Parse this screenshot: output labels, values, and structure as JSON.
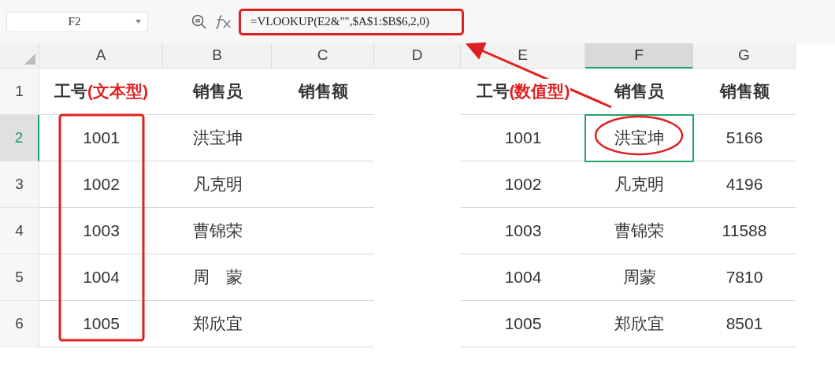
{
  "name_box": {
    "value": "F2"
  },
  "formula_bar": {
    "formula": "=VLOOKUP(E2&\"\",$A$1:$B$6,2,0)"
  },
  "columns": [
    {
      "letter": "A",
      "selected": false
    },
    {
      "letter": "B",
      "selected": false
    },
    {
      "letter": "C",
      "selected": false
    },
    {
      "letter": "D",
      "selected": false
    },
    {
      "letter": "E",
      "selected": false
    },
    {
      "letter": "F",
      "selected": true
    },
    {
      "letter": "G",
      "selected": false
    }
  ],
  "rows": [
    {
      "label": "1",
      "selected": false
    },
    {
      "label": "2",
      "selected": true
    },
    {
      "label": "3",
      "selected": false
    },
    {
      "label": "4",
      "selected": false
    },
    {
      "label": "5",
      "selected": false
    },
    {
      "label": "6",
      "selected": false
    }
  ],
  "left_table": {
    "header": [
      {
        "text": "工号",
        "note": "(文本型)"
      },
      {
        "text": "销售员"
      },
      {
        "text": "销售额"
      }
    ],
    "rows": [
      [
        "1001",
        "洪宝坤"
      ],
      [
        "1002",
        "凡克明"
      ],
      [
        "1003",
        "曹锦荣"
      ],
      [
        "1004",
        "周　蒙"
      ],
      [
        "1005",
        "郑欣宜"
      ]
    ]
  },
  "right_table": {
    "header": [
      {
        "text": "工号",
        "note": "(数值型)"
      },
      {
        "text": "销售员"
      },
      {
        "text": "销售额"
      }
    ],
    "rows": [
      [
        {
          "text": "1001",
          "selected": false
        },
        {
          "text": "洪宝坤",
          "selected": true
        },
        {
          "text": "5166",
          "selected": false
        }
      ],
      [
        {
          "text": "1002",
          "selected": false
        },
        {
          "text": "凡克明",
          "selected": false
        },
        {
          "text": "4196",
          "selected": false
        }
      ],
      [
        {
          "text": "1003",
          "selected": false
        },
        {
          "text": "曹锦荣",
          "selected": false
        },
        {
          "text": "11588",
          "selected": false
        }
      ],
      [
        {
          "text": "1004",
          "selected": false
        },
        {
          "text": "周蒙",
          "selected": false
        },
        {
          "text": "7810",
          "selected": false
        }
      ],
      [
        {
          "text": "1005",
          "selected": false
        },
        {
          "text": "郑欣宜",
          "selected": false
        },
        {
          "text": "8501",
          "selected": false
        }
      ]
    ]
  }
}
